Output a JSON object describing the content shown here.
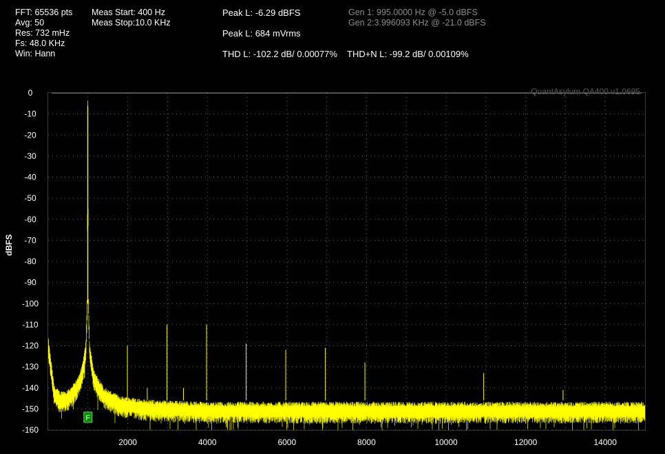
{
  "header": {
    "fft": "FFT: 65536 pts",
    "avg": "Avg: 50",
    "res": "Res: 732 mHz",
    "fs": "Fs: 48.0 KHz",
    "win": "Win: Hann",
    "meas_start": "Meas Start: 400 Hz",
    "meas_stop": "Meas Stop:10.0 KHz",
    "peak_dbfs": "Peak L: -6.29 dBFS",
    "peak_mv": "Peak L: 684 mVrms",
    "thd": "THD L: -102.2 dB/ 0.00077%",
    "thdn": "THD+N L: -99.2 dB/ 0.00109%",
    "gen1": "Gen 1: 995.0000 Hz @ -5.0  dBFS",
    "gen2": "Gen 2:3.996093 KHz @ -21.0  dBFS"
  },
  "watermark": "QuantAsylum QA400 v1.0695",
  "marker_label": "F",
  "colors": {
    "background": "#000000",
    "trace": "#ffff00",
    "grid": "#b0b0b0",
    "marker": "#0a8a0a"
  },
  "chart_data": {
    "type": "line",
    "title": "",
    "xlabel": "",
    "ylabel": "dBFS",
    "xlim": [
      0,
      15000
    ],
    "ylim": [
      -160,
      0
    ],
    "xticks": [
      2000,
      4000,
      6000,
      8000,
      10000,
      12000,
      14000
    ],
    "yticks": [
      0,
      -10,
      -20,
      -30,
      -40,
      -50,
      -60,
      -70,
      -80,
      -90,
      -100,
      -110,
      -120,
      -130,
      -140,
      -150,
      -160
    ],
    "grid": true,
    "marker": {
      "label": "F",
      "x": 1000
    },
    "series": [
      {
        "noise_floor_dbfs": -151,
        "x": [
          0,
          150,
          300,
          500,
          700,
          850,
          950,
          980,
          995,
          1010,
          1040,
          1150,
          1400,
          1800,
          2500,
          4000,
          8000,
          15000
        ],
        "y": [
          -120,
          -143,
          -146,
          -145,
          -141,
          -134,
          -122,
          -100,
          -6.3,
          -100,
          -122,
          -136,
          -144,
          -148,
          -150,
          -151,
          -151,
          -151
        ]
      }
    ],
    "spurs": [
      {
        "x": 1990,
        "y": -120
      },
      {
        "x": 2985,
        "y": -110
      },
      {
        "x": 3980,
        "y": -110
      },
      {
        "x": 4975,
        "y": -119
      },
      {
        "x": 5970,
        "y": -122
      },
      {
        "x": 6965,
        "y": -121
      },
      {
        "x": 7960,
        "y": -128
      },
      {
        "x": 10945,
        "y": -133
      },
      {
        "x": 2490,
        "y": -140
      },
      {
        "x": 3400,
        "y": -140
      },
      {
        "x": 12940,
        "y": -141
      }
    ]
  }
}
